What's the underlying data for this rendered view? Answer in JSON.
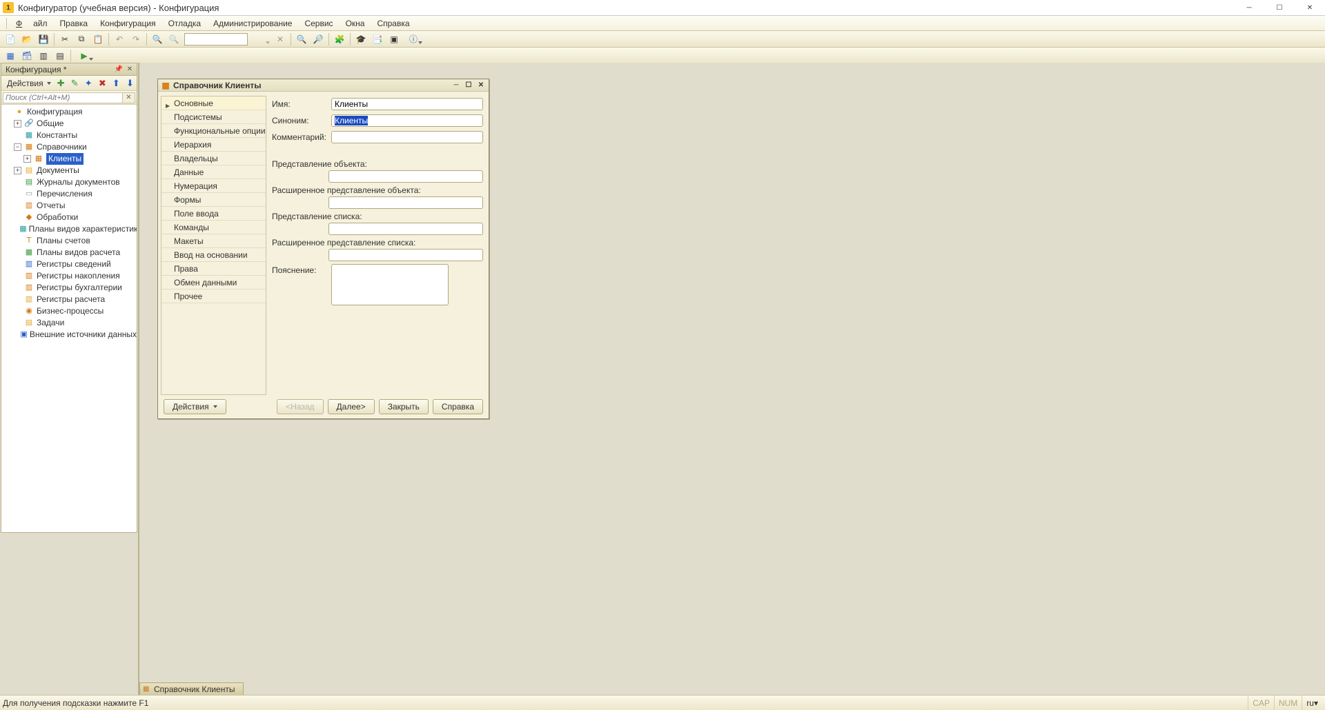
{
  "title": "Конфигуратор (учебная версия) - Конфигурация",
  "menu": {
    "file": "Файл",
    "edit": "Правка",
    "config": "Конфигурация",
    "debug": "Отладка",
    "admin": "Администрирование",
    "service": "Сервис",
    "windows": "Окна",
    "help": "Справка"
  },
  "configPanel": {
    "title": "Конфигурация *",
    "actions_label": "Действия",
    "search_placeholder": "Поиск (Ctrl+Alt+M)",
    "tree": {
      "root": "Конфигурация",
      "items": [
        {
          "label": "Общие",
          "icon": "🔗",
          "exp": "+",
          "indent": 1,
          "icon_name": "general-icon"
        },
        {
          "label": "Константы",
          "icon": "▦",
          "exp": "",
          "indent": 1,
          "color": "i-teal",
          "icon_name": "constants-icon"
        },
        {
          "label": "Справочники",
          "icon": "▦",
          "exp": "−",
          "indent": 1,
          "color": "i-orange",
          "icon_name": "catalogs-icon"
        },
        {
          "label": "Клиенты",
          "icon": "▦",
          "exp": "+",
          "indent": 2,
          "selected": true,
          "color": "i-orange",
          "icon_name": "catalog-clients-icon"
        },
        {
          "label": "Документы",
          "icon": "▤",
          "exp": "+",
          "indent": 1,
          "color": "i-yellow",
          "icon_name": "documents-icon"
        },
        {
          "label": "Журналы документов",
          "icon": "▤",
          "exp": "",
          "indent": 1,
          "color": "i-green",
          "icon_name": "journals-icon"
        },
        {
          "label": "Перечисления",
          "icon": "▭",
          "exp": "",
          "indent": 1,
          "color": "i-gray",
          "icon_name": "enums-icon"
        },
        {
          "label": "Отчеты",
          "icon": "▥",
          "exp": "",
          "indent": 1,
          "color": "i-orange",
          "icon_name": "reports-icon"
        },
        {
          "label": "Обработки",
          "icon": "◆",
          "exp": "",
          "indent": 1,
          "color": "i-orange",
          "icon_name": "processing-icon"
        },
        {
          "label": "Планы видов характеристик",
          "icon": "▦",
          "exp": "",
          "indent": 1,
          "color": "i-teal",
          "icon_name": "char-plans-icon"
        },
        {
          "label": "Планы счетов",
          "icon": "Ｔ",
          "exp": "",
          "indent": 1,
          "color": "i-orange",
          "icon_name": "accounts-icon"
        },
        {
          "label": "Планы видов расчета",
          "icon": "▦",
          "exp": "",
          "indent": 1,
          "color": "i-green",
          "icon_name": "calc-plans-icon"
        },
        {
          "label": "Регистры сведений",
          "icon": "▥",
          "exp": "",
          "indent": 1,
          "color": "i-blue",
          "icon_name": "info-registers-icon"
        },
        {
          "label": "Регистры накопления",
          "icon": "▥",
          "exp": "",
          "indent": 1,
          "color": "i-orange",
          "icon_name": "accum-registers-icon"
        },
        {
          "label": "Регистры бухгалтерии",
          "icon": "▥",
          "exp": "",
          "indent": 1,
          "color": "i-orange",
          "icon_name": "acc-registers-icon"
        },
        {
          "label": "Регистры расчета",
          "icon": "▥",
          "exp": "",
          "indent": 1,
          "color": "i-yellow",
          "icon_name": "calc-registers-icon"
        },
        {
          "label": "Бизнес-процессы",
          "icon": "◉",
          "exp": "",
          "indent": 1,
          "color": "i-orange",
          "icon_name": "bp-icon"
        },
        {
          "label": "Задачи",
          "icon": "▤",
          "exp": "",
          "indent": 1,
          "color": "i-yellow",
          "icon_name": "tasks-icon"
        },
        {
          "label": "Внешние источники данных",
          "icon": "▣",
          "exp": "",
          "indent": 1,
          "color": "i-blue",
          "icon_name": "external-sources-icon"
        }
      ]
    }
  },
  "dialog": {
    "title": "Справочник Клиенты",
    "nav": [
      "Основные",
      "Подсистемы",
      "Функциональные опции",
      "Иерархия",
      "Владельцы",
      "Данные",
      "Нумерация",
      "Формы",
      "Поле ввода",
      "Команды",
      "Макеты",
      "Ввод на основании",
      "Права",
      "Обмен данными",
      "Прочее"
    ],
    "labels": {
      "name": "Имя:",
      "synonym": "Синоним:",
      "comment": "Комментарий:",
      "obj_repr": "Представление объекта:",
      "obj_repr_ext": "Расширенное представление объекта:",
      "list_repr": "Представление списка:",
      "list_repr_ext": "Расширенное представление списка:",
      "explain": "Пояснение:"
    },
    "values": {
      "name": "Клиенты",
      "synonym": "Клиенты",
      "comment": "",
      "obj_repr": "",
      "obj_repr_ext": "",
      "list_repr": "",
      "list_repr_ext": "",
      "explain": ""
    },
    "buttons": {
      "actions": "Действия",
      "back": "<Назад",
      "next": "Далее>",
      "close": "Закрыть",
      "help": "Справка"
    }
  },
  "mdi_tab": "Справочник Клиенты",
  "statusbar": {
    "hint": "Для получения подсказки нажмите F1",
    "cap": "CAP",
    "num": "NUM",
    "lang": "ru"
  }
}
